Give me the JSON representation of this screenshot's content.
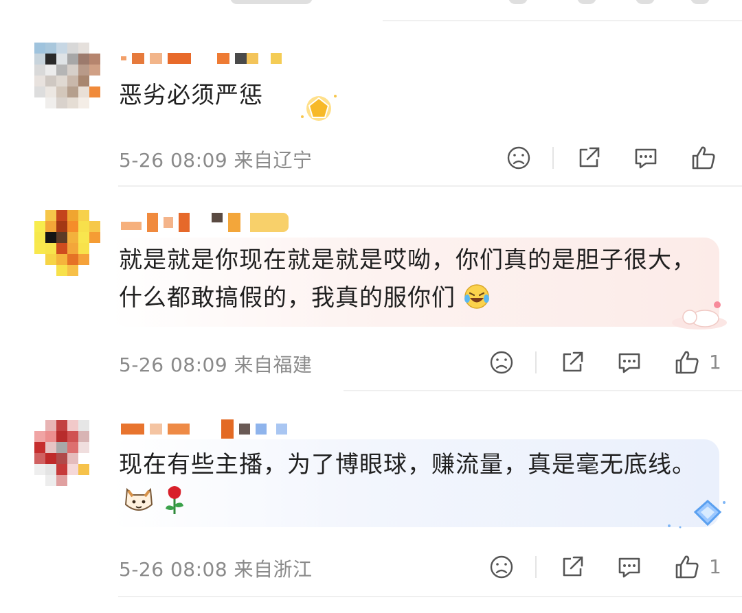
{
  "comments": [
    {
      "text": "恶劣必须严惩",
      "time": "5-26 08:09",
      "location": "来自辽宁",
      "like_count": ""
    },
    {
      "text": "就是就是你现在就是就是哎呦，你们真的是胆子很大，什么都敢搞假的，我真的服你们",
      "time": "5-26 08:09",
      "location": "来自福建",
      "like_count": "1"
    },
    {
      "text": "现在有些主播，为了博眼球，赚流量，真是毫无底线。",
      "time": "5-26 08:08",
      "location": "来自浙江",
      "like_count": "1"
    }
  ],
  "icons": {
    "dislike": "sad-face-icon",
    "share": "share-icon",
    "reply": "comment-icon",
    "like": "thumbs-up-icon"
  },
  "colors": {
    "meta_text": "#8a8a8a",
    "bubble_pink": "#fdf0ef",
    "bubble_blue": "#eef3fd"
  }
}
